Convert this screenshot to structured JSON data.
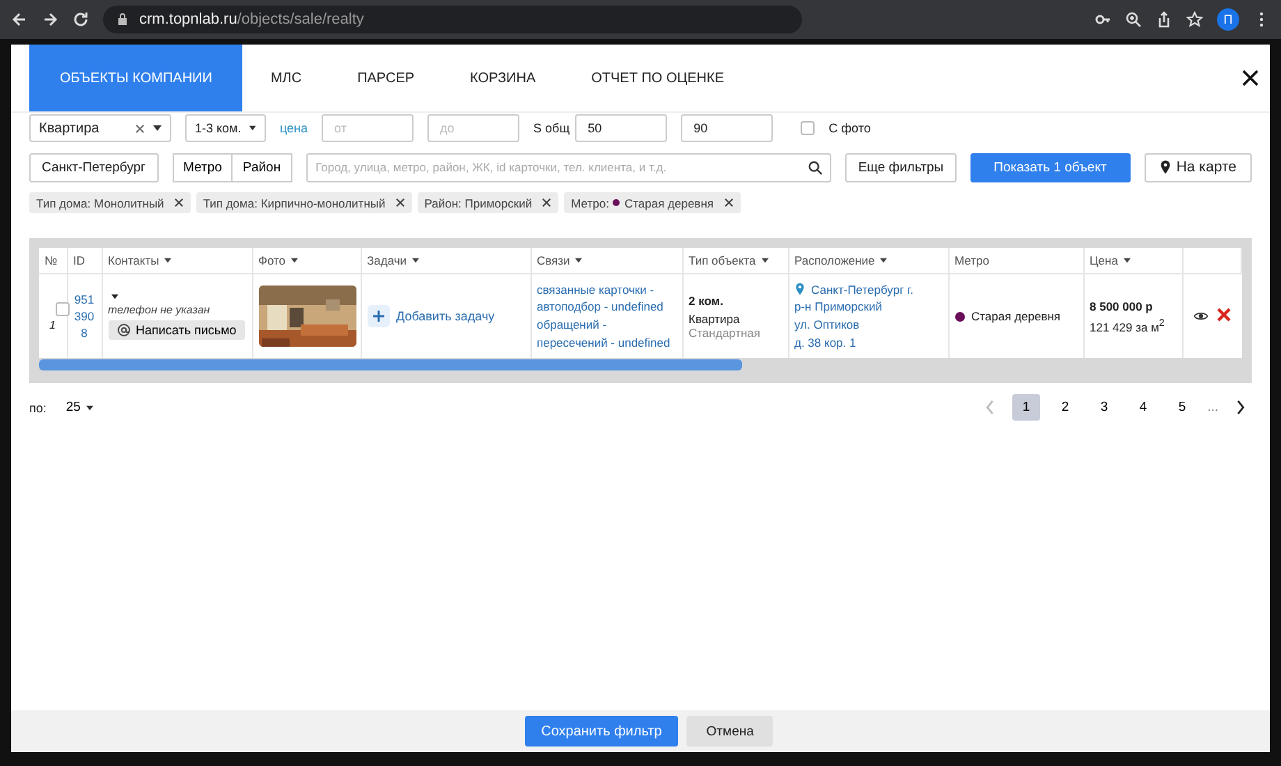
{
  "browser": {
    "url_host": "crm.topnlab.ru",
    "url_path": "/objects/sale/realty",
    "profile": "П"
  },
  "tabs": [
    {
      "label": "ОБЪЕКТЫ КОМПАНИИ",
      "selected": true
    },
    {
      "label": "МЛС",
      "selected": false
    },
    {
      "label": "ПАРСЕР",
      "selected": false
    },
    {
      "label": "КОРЗИНА",
      "selected": false
    },
    {
      "label": "ОТЧЕТ ПО ОЦЕНКЕ",
      "selected": false
    }
  ],
  "filters": {
    "type_select": "Квартира",
    "rooms_select": "1-3 ком.",
    "price_link": "цена",
    "price_from": {
      "placeholder": "от"
    },
    "price_to": {
      "placeholder": "до"
    },
    "area_label": "S общ",
    "area_from": "50",
    "area_to": "90",
    "photo": {
      "label": "С фото",
      "checked": false
    },
    "city_button": "Санкт-Петербург",
    "segments": [
      "Метро",
      "Район"
    ],
    "search": {
      "placeholder": "Город, улица, метро, район, ЖК, id карточки, тел. клиента, и т.д."
    },
    "more_filters": "Еще фильтры",
    "show_button": "Показать 1 объект",
    "map_button": "На карте"
  },
  "chips": [
    {
      "label": "Тип дома: Монолитный"
    },
    {
      "label": "Тип дома: Кирпично-монолитный"
    },
    {
      "label": "Район: Приморский"
    },
    {
      "label": "Метро:",
      "value": "Старая деревня",
      "color": "#6b0f5a"
    }
  ],
  "table": {
    "columns": [
      {
        "label": "№",
        "sortable": false
      },
      {
        "label": "ID",
        "sortable": false
      },
      {
        "label": "Контакты",
        "sortable": true
      },
      {
        "label": "Фото",
        "sortable": true
      },
      {
        "label": "Задачи",
        "sortable": true
      },
      {
        "label": "Связи",
        "sortable": true
      },
      {
        "label": "Тип объекта",
        "sortable": true
      },
      {
        "label": "Расположение",
        "sortable": true
      },
      {
        "label": "Метро",
        "sortable": false
      },
      {
        "label": "Цена",
        "sortable": true
      }
    ],
    "rows": [
      {
        "checked": false,
        "number": "1",
        "id": "9513908",
        "phone": "телефон не указан",
        "write_button": "Написать письмо",
        "task_button": "Добавить задачу",
        "links": [
          "связанные карточки -",
          "автоподбор - undefined",
          "обращений -",
          "пересечений - undefined"
        ],
        "rooms": "2 ком.",
        "type": "Квартира",
        "subtype": "Стандартная",
        "location": [
          "Санкт-Петербург г.",
          "р-н Приморский",
          "ул. Оптиков",
          "д. 38 кор. 1"
        ],
        "metro": "Старая деревня",
        "price": "8 500 000 р",
        "price_per_m": "121 429 за м$^{2}$"
      }
    ]
  },
  "pagination": {
    "per_page_label": "по:",
    "per_page": "25",
    "pages": [
      {
        "label": "1",
        "selected": true
      },
      {
        "label": "2",
        "selected": false
      },
      {
        "label": "3",
        "selected": false
      },
      {
        "label": "4",
        "selected": false
      },
      {
        "label": "5",
        "selected": false
      }
    ],
    "ellipsis": "..."
  },
  "footer": {
    "save_button": "Сохранить фильтр",
    "cancel_button": "Отмена"
  }
}
